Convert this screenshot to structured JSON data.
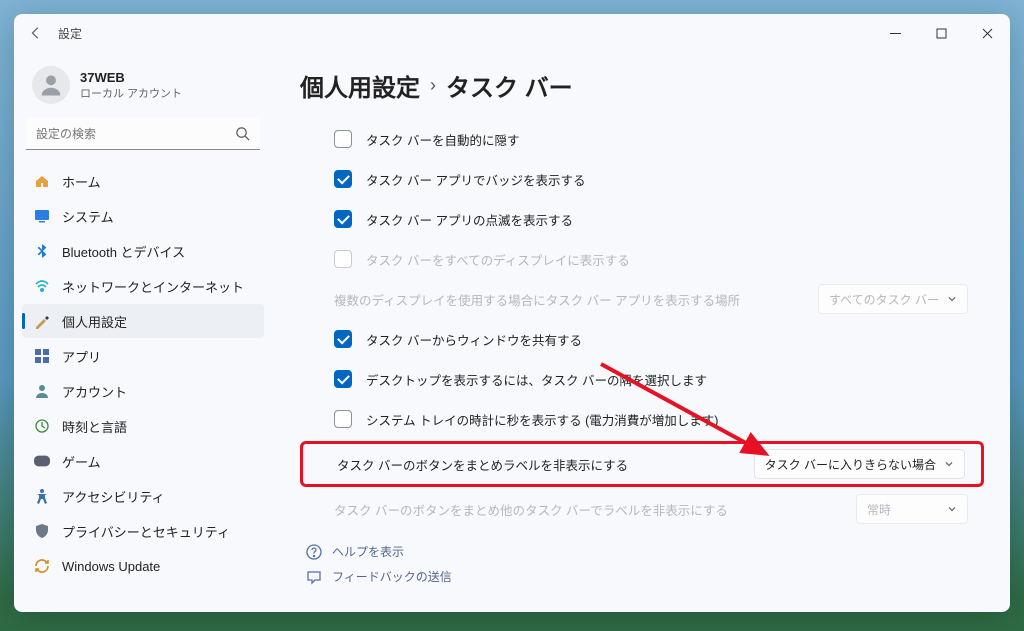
{
  "titlebar": {
    "title": "設定"
  },
  "profile": {
    "name": "37WEB",
    "sub": "ローカル アカウント"
  },
  "search": {
    "placeholder": "設定の検索"
  },
  "nav": [
    {
      "label": "ホーム",
      "icon": "home"
    },
    {
      "label": "システム",
      "icon": "system"
    },
    {
      "label": "Bluetooth とデバイス",
      "icon": "bluetooth"
    },
    {
      "label": "ネットワークとインターネット",
      "icon": "network"
    },
    {
      "label": "個人用設定",
      "icon": "personalize",
      "active": true
    },
    {
      "label": "アプリ",
      "icon": "apps"
    },
    {
      "label": "アカウント",
      "icon": "account"
    },
    {
      "label": "時刻と言語",
      "icon": "time"
    },
    {
      "label": "ゲーム",
      "icon": "game"
    },
    {
      "label": "アクセシビリティ",
      "icon": "access"
    },
    {
      "label": "プライバシーとセキュリティ",
      "icon": "privacy"
    },
    {
      "label": "Windows Update",
      "icon": "update"
    }
  ],
  "breadcrumb": {
    "parent": "個人用設定",
    "current": "タスク バー"
  },
  "settings": [
    {
      "type": "check",
      "key": "autohide",
      "label": "タスク バーを自動的に隠す",
      "checked": false,
      "disabled": false
    },
    {
      "type": "check",
      "key": "badges",
      "label": "タスク バー アプリでバッジを表示する",
      "checked": true,
      "disabled": false
    },
    {
      "type": "check",
      "key": "flash",
      "label": "タスク バー アプリの点滅を表示する",
      "checked": true,
      "disabled": false
    },
    {
      "type": "check",
      "key": "alldisp",
      "label": "タスク バーをすべてのディスプレイに表示する",
      "checked": false,
      "disabled": true
    },
    {
      "type": "combo",
      "key": "multidisp",
      "label": "複数のディスプレイを使用する場合にタスク バー アプリを表示する場所",
      "value": "すべてのタスク バー",
      "disabled": true
    },
    {
      "type": "check",
      "key": "sharewin",
      "label": "タスク バーからウィンドウを共有する",
      "checked": true,
      "disabled": false
    },
    {
      "type": "check",
      "key": "showdesk",
      "label": "デスクトップを表示するには、タスク バーの隅を選択します",
      "checked": true,
      "disabled": false
    },
    {
      "type": "check",
      "key": "seconds",
      "label": "システム トレイの時計に秒を表示する (電力消費が増加します)",
      "checked": false,
      "disabled": false
    },
    {
      "type": "combo",
      "key": "combine",
      "label": "タスク バーのボタンをまとめラベルを非表示にする",
      "value": "タスク バーに入りきらない場合",
      "disabled": false,
      "highlight": true
    },
    {
      "type": "combo",
      "key": "combine2",
      "label": "タスク バーのボタンをまとめ他のタスク バーでラベルを非表示にする",
      "value": "常時",
      "disabled": true
    }
  ],
  "footer": {
    "help": "ヘルプを表示",
    "feedback": "フィードバックの送信"
  }
}
